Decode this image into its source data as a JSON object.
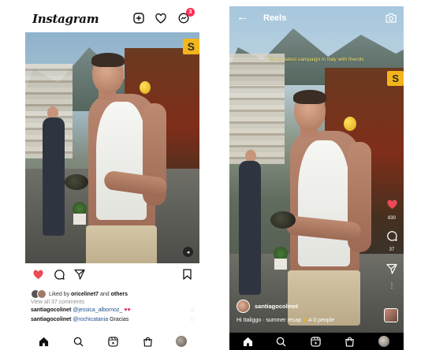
{
  "feed": {
    "app_name": "Instagram",
    "notification_count": "3",
    "liked_prefix": "Liked by",
    "liked_user": "oricelinet7",
    "liked_and": "and",
    "liked_others": "others",
    "view_comments": "View all 37 comments",
    "comments": [
      {
        "user": "santiagocolinet",
        "mention": "@jessica_albornoz_",
        "extra": "",
        "hearts": "♥♥"
      },
      {
        "user": "santiagocolinet",
        "mention": "@rochicatania",
        "extra": "Gracias",
        "hearts": ""
      }
    ]
  },
  "reels": {
    "title": "Reels",
    "overlay_text": "To my latest campaign in Italy with friends",
    "like_count": "830",
    "comment_count": "37",
    "username": "santiagocolinet",
    "caption_text": "Hi Italiggo · summer recap",
    "caption_people": "A 0 people"
  },
  "post_sign_text": "S",
  "icons": {
    "add": "add-post-icon",
    "heart": "heart-icon",
    "messenger": "messenger-icon",
    "like": "like-icon",
    "comment": "comment-icon",
    "share": "share-icon",
    "save": "save-icon",
    "home": "home-icon",
    "search": "search-icon",
    "reels": "reels-icon",
    "shop": "shop-icon",
    "camera": "camera-icon",
    "more": "more-icon"
  },
  "colors": {
    "like_red": "#ed4956",
    "notif": "#ff2d55",
    "overlay_yellow": "#f3e36a"
  }
}
